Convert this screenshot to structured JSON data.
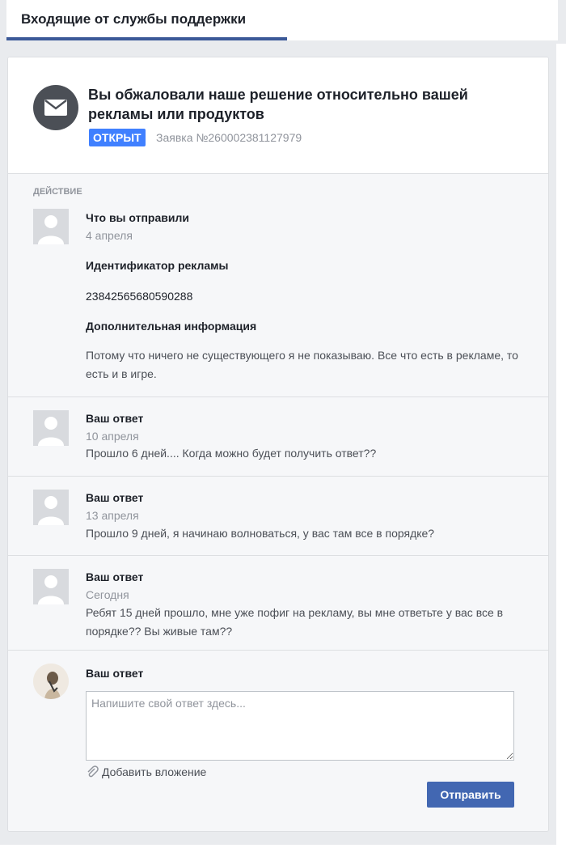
{
  "tab": {
    "label": "Входящие от службы поддержки"
  },
  "ticket": {
    "title": "Вы обжаловали наше решение относительно вашей рекламы или продуктов",
    "status": "ОТКРЫТ",
    "number": "Заявка №260002381127979",
    "status_color": "#4080ff"
  },
  "section": {
    "label": "ДЕЙСТВИЕ"
  },
  "submission": {
    "author": "Что вы отправили",
    "date": "4 апреля",
    "ad_id_label": "Идентификатор рекламы",
    "ad_id_value": "23842565680590288",
    "extra_label": "Дополнительная информация",
    "extra_text": "Потому что ничего не существующего я не показываю. Все что есть в рекламе, то есть и в игре."
  },
  "messages": [
    {
      "author": "Ваш ответ",
      "date": "10 апреля",
      "text": "Прошло 6 дней.... Когда можно будет получить ответ??"
    },
    {
      "author": "Ваш ответ",
      "date": "13 апреля",
      "text": "Прошло 9 дней, я начинаю волноваться, у вас там все в порядке?"
    },
    {
      "author": "Ваш ответ",
      "date": "Сегодня",
      "text": "Ребят 15 дней прошло, мне уже пофиг на рекламу, вы мне ответьте у вас все в порядке?? Вы живые там??"
    }
  ],
  "reply": {
    "heading": "Ваш ответ",
    "placeholder": "Напишите свой ответ здесь...",
    "attach_label": "Добавить вложение",
    "send_label": "Отправить"
  },
  "colors": {
    "accent": "#3b5998",
    "button": "#4267b2",
    "badge": "#4080ff"
  },
  "icons": {
    "ticket": "envelope-icon",
    "attach": "paperclip-icon",
    "avatar": "default-person-icon"
  }
}
